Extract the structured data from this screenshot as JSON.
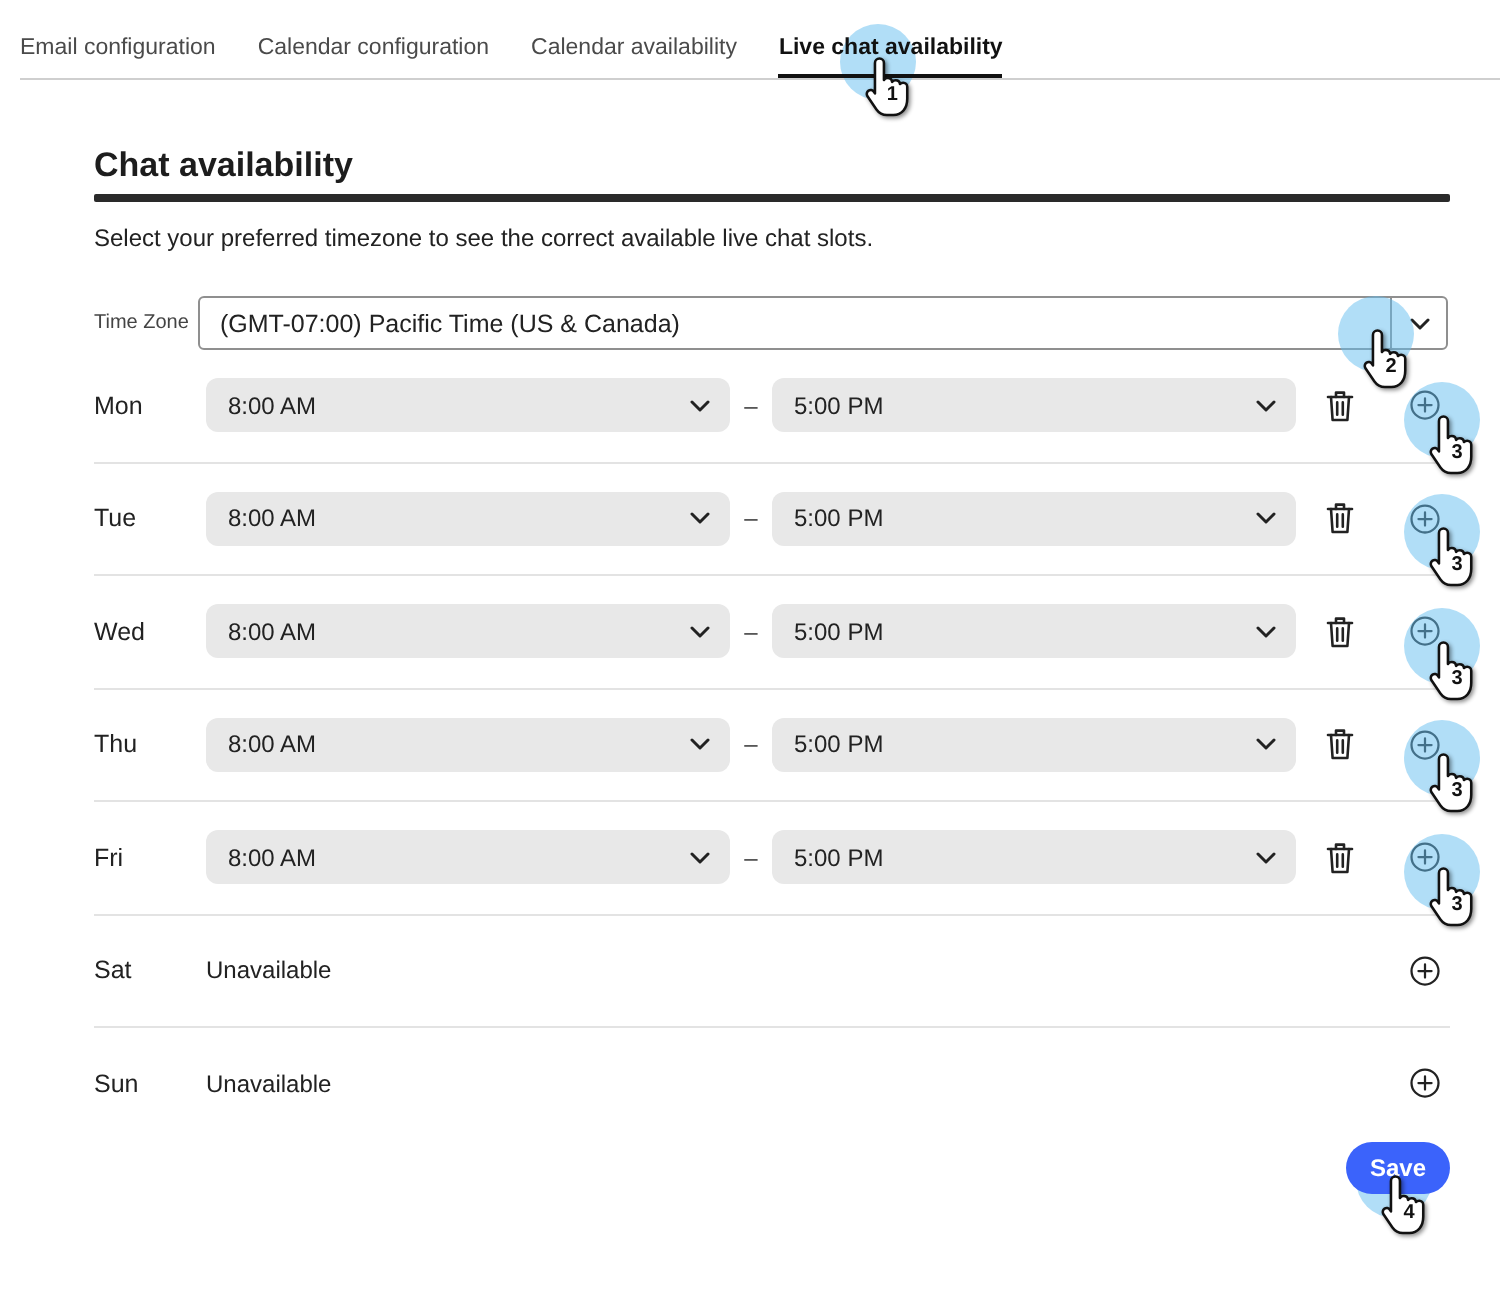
{
  "tabs": [
    {
      "label": "Email configuration",
      "selected": false
    },
    {
      "label": "Calendar configuration",
      "selected": false
    },
    {
      "label": "Calendar availability",
      "selected": false
    },
    {
      "label": "Live chat availability",
      "selected": true,
      "callout": "1"
    }
  ],
  "panel": {
    "title": "Chat availability",
    "description": "Select your preferred timezone to see the correct available live chat slots.",
    "time_zone": {
      "label": "Time Zone",
      "value": "(GMT-07:00) Pacific Time (US & Canada)",
      "callout": "2"
    },
    "days": [
      {
        "day": "Mon",
        "kind": "slot",
        "start": "8:00 AM",
        "separator": "–",
        "end": "5:00 PM",
        "callout": "3"
      },
      {
        "day": "Tue",
        "kind": "slot",
        "start": "8:00 AM",
        "separator": "–",
        "end": "5:00 PM",
        "callout": "3"
      },
      {
        "day": "Wed",
        "kind": "slot",
        "start": "8:00 AM",
        "separator": "–",
        "end": "5:00 PM",
        "callout": "3"
      },
      {
        "day": "Thu",
        "kind": "slot",
        "start": "8:00 AM",
        "separator": "–",
        "end": "5:00 PM",
        "callout": "3"
      },
      {
        "day": "Fri",
        "kind": "slot",
        "start": "8:00 AM",
        "separator": "–",
        "end": "5:00 PM",
        "callout": "3"
      },
      {
        "day": "Sat",
        "kind": "unavailable",
        "status": "Unavailable"
      },
      {
        "day": "Sun",
        "kind": "unavailable",
        "status": "Unavailable"
      }
    ],
    "save_button": {
      "label": "Save",
      "callout": "4"
    }
  }
}
